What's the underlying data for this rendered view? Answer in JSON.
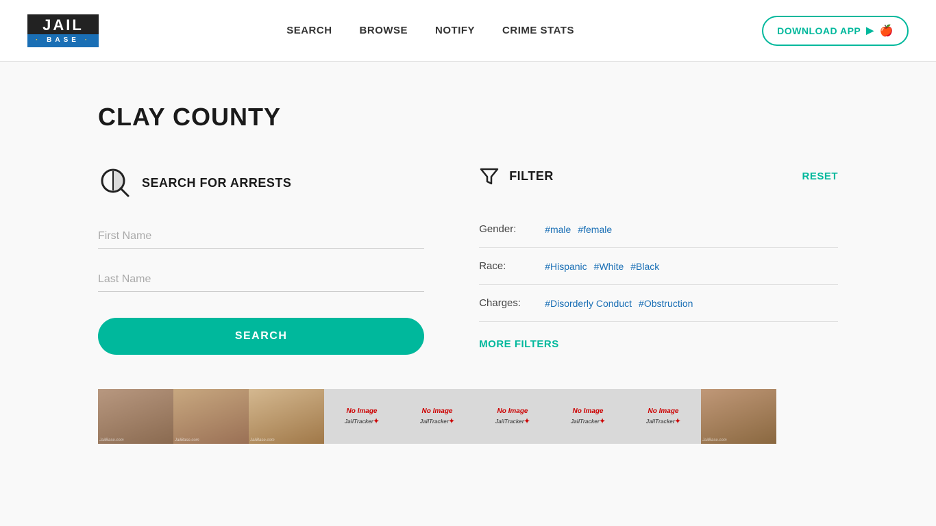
{
  "header": {
    "logo": {
      "jail_text": "JAIL",
      "base_text": "BASE",
      "dots": "·★·"
    },
    "nav": {
      "search": "SEARCH",
      "browse": "BROWSE",
      "notify": "NOTIFY",
      "crime_stats": "CRIME STATS"
    },
    "download_btn": "DOWNLOAD APP"
  },
  "main": {
    "page_title": "CLAY COUNTY",
    "search_section": {
      "icon_label": "search-magnifier-icon",
      "title": "SEARCH FOR ARRESTS",
      "first_name_placeholder": "First Name",
      "last_name_placeholder": "Last Name",
      "search_button": "SEARCH"
    },
    "filter_section": {
      "title": "FILTER",
      "reset_button": "RESET",
      "rows": [
        {
          "label": "Gender:",
          "tags": [
            "#male",
            "#female"
          ]
        },
        {
          "label": "Race:",
          "tags": [
            "#Hispanic",
            "#White",
            "#Black"
          ]
        },
        {
          "label": "Charges:",
          "tags": [
            "#Disorderly Conduct",
            "#Obstruction"
          ]
        }
      ],
      "more_filters_button": "MORE FILTERS"
    },
    "mugshots": [
      {
        "type": "real",
        "id": 1
      },
      {
        "type": "real",
        "id": 2
      },
      {
        "type": "real",
        "id": 3
      },
      {
        "type": "placeholder",
        "id": 4
      },
      {
        "type": "placeholder",
        "id": 5
      },
      {
        "type": "placeholder",
        "id": 6
      },
      {
        "type": "placeholder",
        "id": 7
      },
      {
        "type": "placeholder",
        "id": 8
      },
      {
        "type": "real",
        "id": 9
      }
    ],
    "no_image_text": "No Image",
    "jailtracker_text": "JailTracker"
  }
}
